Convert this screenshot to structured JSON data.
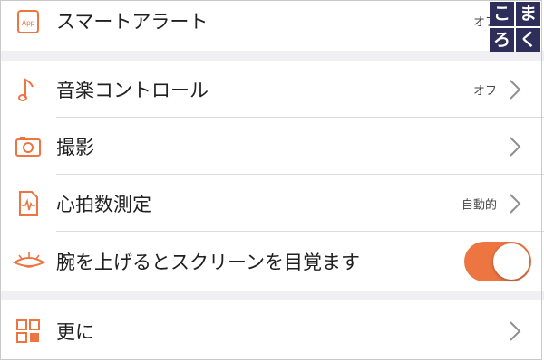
{
  "settings": {
    "smart_alert": {
      "label": "スマートアラート",
      "value": "オフ",
      "icon": "app-icon"
    },
    "music_control": {
      "label": "音楽コントロール",
      "value": "オフ",
      "icon": "music-note-icon"
    },
    "camera": {
      "label": "撮影",
      "icon": "camera-icon"
    },
    "heart_rate": {
      "label": "心拍数測定",
      "value": "自動的",
      "icon": "heart-rate-icon"
    },
    "wrist_wake": {
      "label": "腕を上げるとスクリーンを目覚ます",
      "toggle_on": true,
      "icon": "eye-icon"
    },
    "more": {
      "label": "更に",
      "icon": "grid-icon"
    }
  },
  "watermark": {
    "chars": [
      "こ",
      "ま",
      "ろ",
      "く"
    ]
  },
  "colors": {
    "accent": "#ec7542",
    "toggle_on": "#ec7542",
    "background": "#efeff4",
    "watermark_bg": "#2d2f5a"
  }
}
